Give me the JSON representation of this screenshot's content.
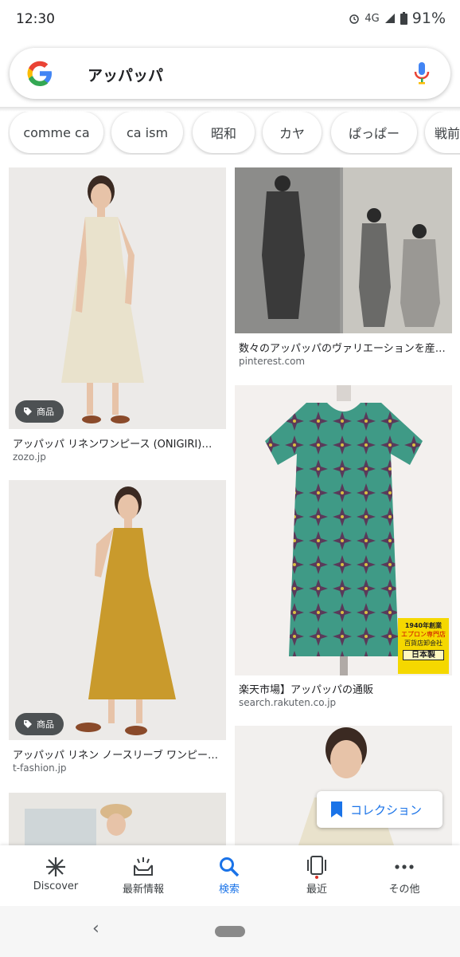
{
  "status_bar": {
    "time": "12:30",
    "network": "4G",
    "battery": "91%"
  },
  "search": {
    "query": "アッパッパ"
  },
  "chips": [
    "comme ca",
    "ca ism",
    "昭和",
    "カヤ",
    "ぱっぱー",
    "戦前"
  ],
  "results": [
    {
      "caption": "アッパッパ リネンワンピース (ONIGIRI)…",
      "source": "zozo.jp",
      "badge": "商品"
    },
    {
      "caption": "数々のアッパッパのヴァリエーションを産…",
      "source": "pinterest.com"
    },
    {
      "caption": "アッパッパ リネン ノースリーブ ワンピー…",
      "source": "t-fashion.jp",
      "badge": "商品"
    },
    {
      "caption": "楽天市場】アッパッパの通販",
      "source": "search.rakuten.co.jp"
    }
  ],
  "rakuten_tag": {
    "line1": "1940年創業",
    "line2": "エプロン専門店",
    "line3": "百貨店卸会社",
    "line4": "日本製"
  },
  "collection_button": "コレクション",
  "bottom_nav": [
    {
      "label": "Discover",
      "icon": "asterisk-icon"
    },
    {
      "label": "最新情報",
      "icon": "updates-icon"
    },
    {
      "label": "検索",
      "icon": "search-icon"
    },
    {
      "label": "最近",
      "icon": "recents-icon"
    },
    {
      "label": "その他",
      "icon": "more-icon"
    }
  ],
  "colors": {
    "accent": "#1a73e8",
    "dress_cream": "#e9e2cc",
    "dress_mustard": "#c99a2c",
    "dress_teal": "#3f9a86"
  }
}
